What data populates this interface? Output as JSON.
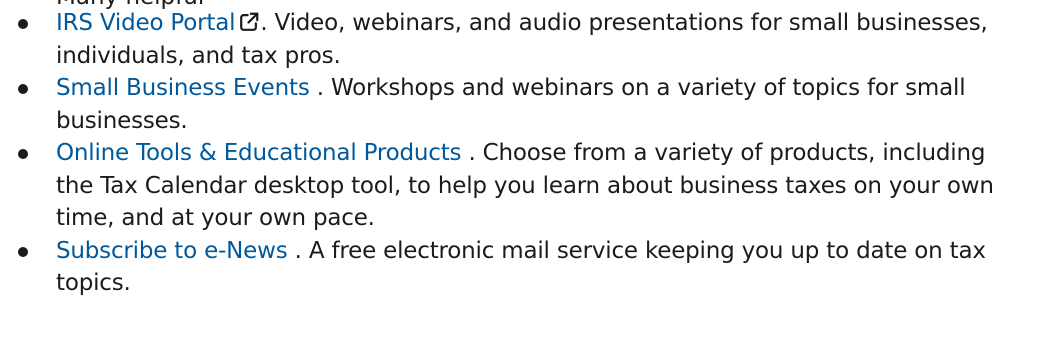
{
  "clipped_heading": "Many helpful",
  "items": [
    {
      "link": "IRS Video Portal",
      "external": true,
      "separator": ". ",
      "text": "Video, webinars, and audio presentations for small businesses, individuals, and tax pros."
    },
    {
      "link": "Small Business Events",
      "external": false,
      "separator": " . ",
      "text": "Workshops and webinars on a variety of topics for small businesses."
    },
    {
      "link": "Online Tools & Educational Products",
      "external": false,
      "separator": " . ",
      "text": "Choose from a variety of products, including the Tax Calendar desktop tool, to help you learn about business taxes on your own time, and at your own pace."
    },
    {
      "link": "Subscribe to e-News",
      "external": false,
      "separator": " . ",
      "text": "A free electronic mail service keeping you up to date on tax topics."
    }
  ],
  "icons": {
    "external_link": "external-link-icon"
  },
  "colors": {
    "link": "#00599c",
    "text": "#1b1b1b",
    "background": "#ffffff"
  }
}
